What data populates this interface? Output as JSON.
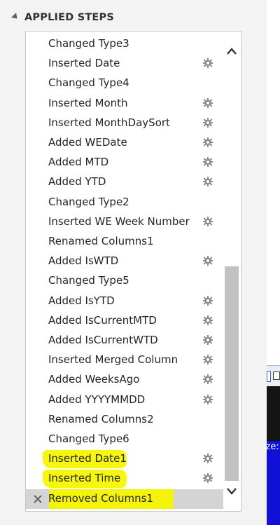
{
  "section": {
    "title": "APPLIED STEPS"
  },
  "steps": [
    {
      "label": "Changed Type3",
      "gear": false
    },
    {
      "label": "Inserted Date",
      "gear": true
    },
    {
      "label": "Changed Type4",
      "gear": false
    },
    {
      "label": "Inserted Month",
      "gear": true
    },
    {
      "label": "Inserted MonthDaySort",
      "gear": true
    },
    {
      "label": "Added WEDate",
      "gear": true
    },
    {
      "label": "Added MTD",
      "gear": true
    },
    {
      "label": "Added YTD",
      "gear": true
    },
    {
      "label": "Changed Type2",
      "gear": false
    },
    {
      "label": "Inserted WE Week Number",
      "gear": true
    },
    {
      "label": "Renamed Columns1",
      "gear": false
    },
    {
      "label": "Added IsWTD",
      "gear": true
    },
    {
      "label": "Changed Type5",
      "gear": false
    },
    {
      "label": "Added IsYTD",
      "gear": true
    },
    {
      "label": "Added IsCurrentMTD",
      "gear": true
    },
    {
      "label": "Added IsCurrentWTD",
      "gear": true
    },
    {
      "label": "Inserted Merged Column",
      "gear": true
    },
    {
      "label": "Added WeeksAgo",
      "gear": true
    },
    {
      "label": "Added YYYYMMDD",
      "gear": true
    },
    {
      "label": "Renamed Columns2",
      "gear": false
    },
    {
      "label": "Changed Type6",
      "gear": false
    },
    {
      "label": "Inserted Date1",
      "gear": true,
      "highlight": true
    },
    {
      "label": "Inserted Time",
      "gear": true,
      "highlight": true
    },
    {
      "label": "Removed Columns1",
      "gear": false,
      "selected": true,
      "highlight": true
    }
  ],
  "right_strip": {
    "partial_text": "ize:"
  },
  "colors": {
    "highlight": "#f6f60e",
    "selected_bg": "#d4d4d4",
    "accent_blue": "#1010d6"
  }
}
